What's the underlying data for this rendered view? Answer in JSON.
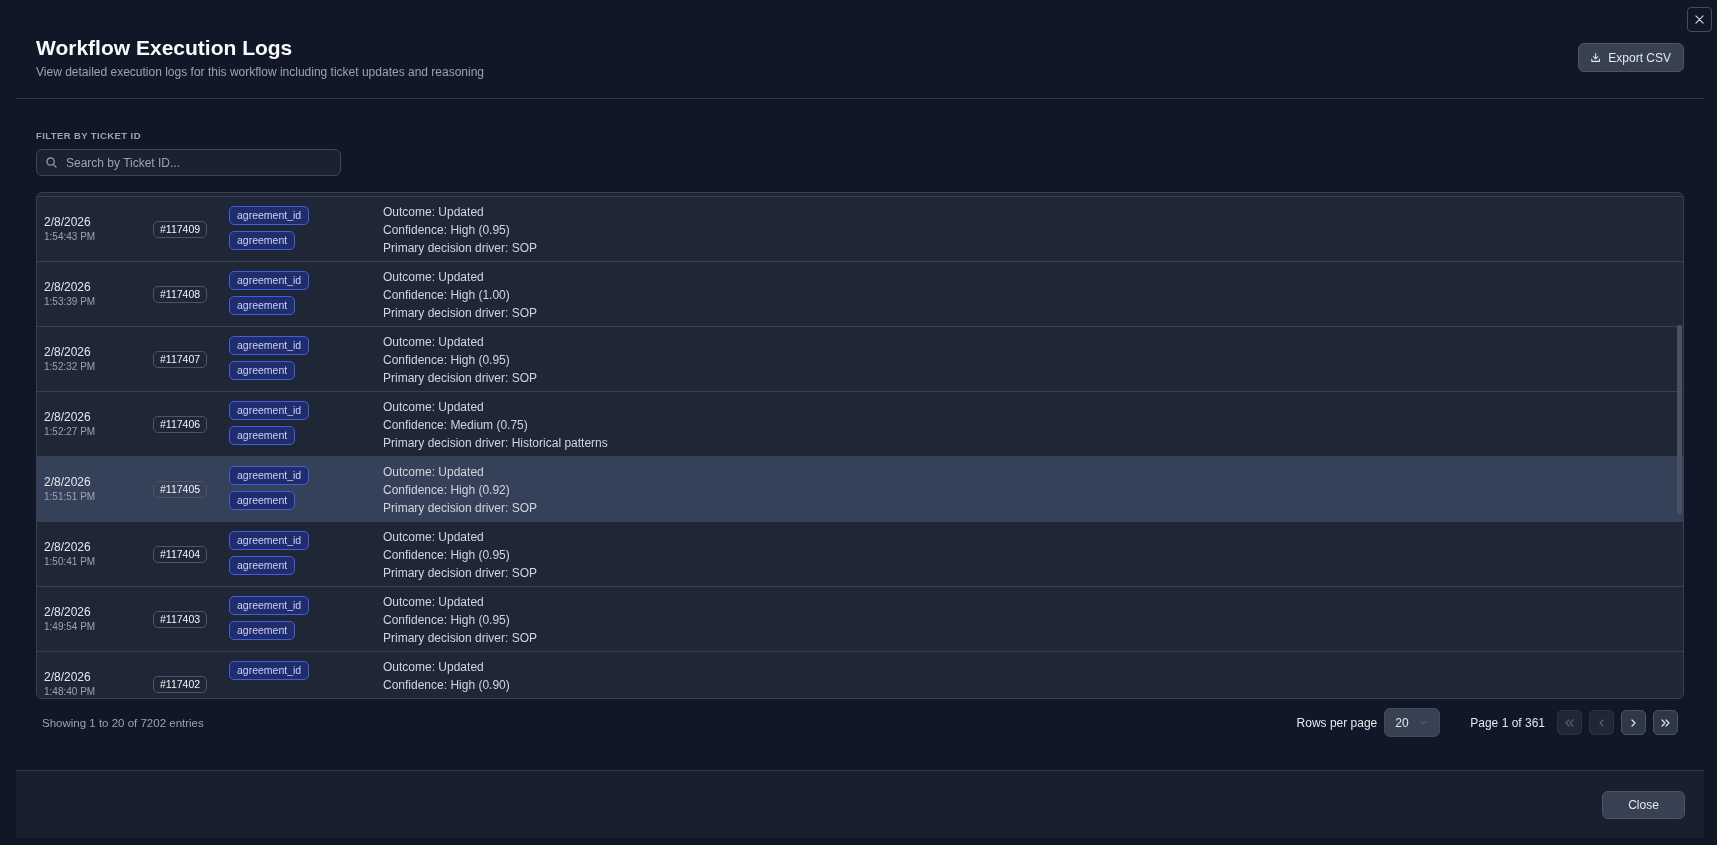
{
  "dialog": {
    "title": "Workflow Execution Logs",
    "subtitle": "View detailed execution logs for this workflow including ticket updates and reasoning",
    "export_label": "Export CSV"
  },
  "filter": {
    "label": "FILTER BY TICKET ID",
    "placeholder": "Search by Ticket ID..."
  },
  "log_rows": [
    {
      "date": "2/8/2026",
      "time": "1:54:43 PM",
      "ticket": "#117409",
      "tags": [
        "agreement_id",
        "agreement"
      ],
      "details": [
        "Outcome: Updated",
        "Confidence: High (0.95)",
        "Primary decision driver: SOP"
      ],
      "hovered": false
    },
    {
      "date": "2/8/2026",
      "time": "1:53:39 PM",
      "ticket": "#117408",
      "tags": [
        "agreement_id",
        "agreement"
      ],
      "details": [
        "Outcome: Updated",
        "Confidence: High (1.00)",
        "Primary decision driver: SOP"
      ],
      "hovered": false
    },
    {
      "date": "2/8/2026",
      "time": "1:52:32 PM",
      "ticket": "#117407",
      "tags": [
        "agreement_id",
        "agreement"
      ],
      "details": [
        "Outcome: Updated",
        "Confidence: High (0.95)",
        "Primary decision driver: SOP"
      ],
      "hovered": false
    },
    {
      "date": "2/8/2026",
      "time": "1:52:27 PM",
      "ticket": "#117406",
      "tags": [
        "agreement_id",
        "agreement"
      ],
      "details": [
        "Outcome: Updated",
        "Confidence: Medium (0.75)",
        "Primary decision driver: Historical patterns"
      ],
      "hovered": false
    },
    {
      "date": "2/8/2026",
      "time": "1:51:51 PM",
      "ticket": "#117405",
      "tags": [
        "agreement_id",
        "agreement"
      ],
      "details": [
        "Outcome: Updated",
        "Confidence: High (0.92)",
        "Primary decision driver: SOP"
      ],
      "hovered": true
    },
    {
      "date": "2/8/2026",
      "time": "1:50:41 PM",
      "ticket": "#117404",
      "tags": [
        "agreement_id",
        "agreement"
      ],
      "details": [
        "Outcome: Updated",
        "Confidence: High (0.95)",
        "Primary decision driver: SOP"
      ],
      "hovered": false
    },
    {
      "date": "2/8/2026",
      "time": "1:49:54 PM",
      "ticket": "#117403",
      "tags": [
        "agreement_id",
        "agreement"
      ],
      "details": [
        "Outcome: Updated",
        "Confidence: High (0.95)",
        "Primary decision driver: SOP"
      ],
      "hovered": false
    },
    {
      "date": "2/8/2026",
      "time": "1:48:40 PM",
      "ticket": "#117402",
      "tags": [
        "agreement_id"
      ],
      "details": [
        "Outcome: Updated",
        "Confidence: High (0.90)"
      ],
      "hovered": false
    }
  ],
  "pagination": {
    "summary": "Showing 1 to 20 of 7202 entries",
    "rows_per_page_label": "Rows per page",
    "rows_per_page": "20",
    "page_label": "Page 1 of 361",
    "buttons": [
      {
        "kind": "first",
        "disabled": true
      },
      {
        "kind": "previous",
        "disabled": true
      },
      {
        "kind": "next",
        "disabled": false
      },
      {
        "kind": "last",
        "disabled": false
      }
    ]
  },
  "footer": {
    "close_label": "Close"
  }
}
